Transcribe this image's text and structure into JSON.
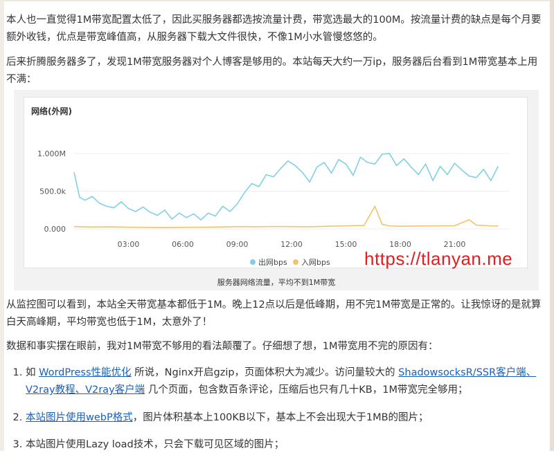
{
  "article": {
    "p1": "本人也一直觉得1M带宽配置太低了，因此买服务器都选按流量计费，带宽选最大的100M。按流量计费的缺点是每个月要额外收钱，优点是带宽峰值高，从服务器下载大文件很快，不像1M小水管慢悠悠的。",
    "p2": "后来折腾服务器多了，发现1M带宽服务器对个人博客是够用的。本站每天大约一万ip，服务器后台看到1M带宽基本上用不满：",
    "caption": "服务器网络流量，平均不到1M带宽",
    "watermark": "https://tlanyan.me",
    "p3": "从监控图可以看到，本站全天带宽基本都低于1M。晚上12点以后是低峰期，用不完1M带宽是正常的。让我惊讶的是就算白天高峰期，平均带宽也低于1M，太意外了！",
    "p4": "数据和事实摆在眼前，我对1M带宽不够用的看法颠覆了。仔细想了想，1M带宽用不完的原因有：",
    "list": {
      "item1": {
        "pre": "如 ",
        "link1": "WordPress性能优化",
        "mid1": " 所说，Nginx开启gzip，页面体积大为减少。访问量较大的 ",
        "link2": "ShadowsocksR/SSR客户端",
        "sep1": "、",
        "link3": "V2ray教程",
        "sep2": "、",
        "link4": "V2ray客户端",
        "post": " 几个页面，包含数百条评论，压缩后也只有几十KB，1M带宽完全够用；"
      },
      "item2": {
        "link": "本站图片使用webP格式",
        "post": "，图片体积基本上100KB以下，基本上不会出现大于1MB的图片；"
      },
      "item3": {
        "text": "本站图片使用Lazy load技术，只会下载可见区域的图片；"
      }
    }
  },
  "colors": {
    "out": "#7fd0e6",
    "in": "#f0c46a",
    "link": "#1a5fb4",
    "watermark": "#e02020"
  },
  "chart_data": {
    "type": "line",
    "title": "网络(外网)",
    "yticks": [
      "0.000",
      "500.0k",
      "1.000M"
    ],
    "xticks": [
      "03:00",
      "06:00",
      "09:00",
      "12:00",
      "15:00",
      "18:00",
      "21:00"
    ],
    "ylim": [
      0,
      1100000
    ],
    "xlim": [
      0,
      24
    ],
    "legend_position": "bottom",
    "series": [
      {
        "name": "出网bps",
        "color": "#7fd0e6",
        "x": [
          0,
          0.3,
          0.6,
          1,
          1.4,
          1.8,
          2.2,
          2.6,
          3,
          3.4,
          3.8,
          4.2,
          4.6,
          5,
          5.4,
          5.8,
          6.2,
          6.6,
          7,
          7.4,
          7.8,
          8.2,
          8.6,
          9,
          9.4,
          9.8,
          10.2,
          10.6,
          11,
          11.4,
          11.8,
          12.2,
          12.6,
          13,
          13.4,
          13.8,
          14.2,
          14.6,
          15,
          15.4,
          15.8,
          16.2,
          16.6,
          17,
          17.4,
          17.8,
          18.2,
          18.6,
          19,
          19.4,
          19.8,
          20.2,
          20.6,
          21,
          21.4,
          21.8,
          22.2,
          22.6,
          23,
          23.4
        ],
        "y": [
          750000,
          420000,
          380000,
          430000,
          340000,
          300000,
          280000,
          360000,
          270000,
          230000,
          290000,
          220000,
          180000,
          250000,
          130000,
          210000,
          150000,
          200000,
          120000,
          210000,
          170000,
          300000,
          230000,
          330000,
          480000,
          600000,
          560000,
          720000,
          690000,
          800000,
          900000,
          840000,
          750000,
          620000,
          820000,
          880000,
          740000,
          920000,
          860000,
          710000,
          950000,
          880000,
          860000,
          990000,
          1000000,
          840000,
          930000,
          820000,
          720000,
          860000,
          640000,
          830000,
          720000,
          870000,
          780000,
          700000,
          680000,
          790000,
          640000,
          830000
        ]
      },
      {
        "name": "入网bps",
        "color": "#f0c46a",
        "x": [
          0,
          1,
          2,
          3,
          4,
          5,
          6,
          7,
          8,
          9,
          10,
          11,
          12,
          13,
          14,
          15,
          16,
          16.6,
          17,
          17.4,
          18,
          19,
          20,
          21,
          21.8,
          22.2,
          23,
          23.4
        ],
        "y": [
          30000,
          25000,
          28000,
          22000,
          20000,
          18000,
          20000,
          22000,
          25000,
          30000,
          28000,
          32000,
          30000,
          28000,
          35000,
          40000,
          45000,
          300000,
          60000,
          40000,
          35000,
          38000,
          40000,
          42000,
          120000,
          50000,
          40000,
          38000
        ]
      }
    ]
  }
}
